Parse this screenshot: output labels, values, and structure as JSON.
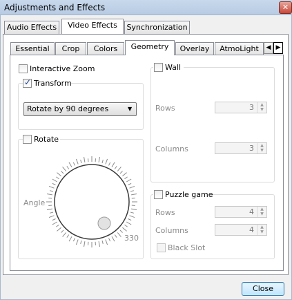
{
  "window": {
    "title": "Adjustments and Effects",
    "close_glyph": "✕"
  },
  "main_tabs": [
    {
      "label": "Audio Effects"
    },
    {
      "label": "Video Effects",
      "active": true
    },
    {
      "label": "Synchronization"
    }
  ],
  "sub_tabs": [
    {
      "label": "Essential"
    },
    {
      "label": "Crop"
    },
    {
      "label": "Colors"
    },
    {
      "label": "Geometry",
      "active": true
    },
    {
      "label": "Overlay"
    },
    {
      "label": "AtmoLight"
    }
  ],
  "scroll": {
    "left_glyph": "◀",
    "right_glyph": "▶"
  },
  "interactive_zoom": {
    "label": "Interactive Zoom",
    "checked": false
  },
  "transform": {
    "label": "Transform",
    "checked": true,
    "select_value": "Rotate by 90 degrees",
    "arrow_glyph": "▼"
  },
  "rotate": {
    "label": "Rotate",
    "checked": false,
    "angle_label": "Angle",
    "angle_value": "330",
    "angle_degrees": 330
  },
  "wall": {
    "label": "Wall",
    "checked": false,
    "rows_label": "Rows",
    "rows_value": "3",
    "columns_label": "Columns",
    "columns_value": "3"
  },
  "puzzle": {
    "label": "Puzzle game",
    "checked": false,
    "rows_label": "Rows",
    "rows_value": "4",
    "columns_label": "Columns",
    "columns_value": "4",
    "black_slot_label": "Black Slot",
    "black_slot_checked": false
  },
  "spin_glyphs": {
    "up": "▲",
    "down": "▼"
  },
  "footer": {
    "close_label": "Close"
  }
}
